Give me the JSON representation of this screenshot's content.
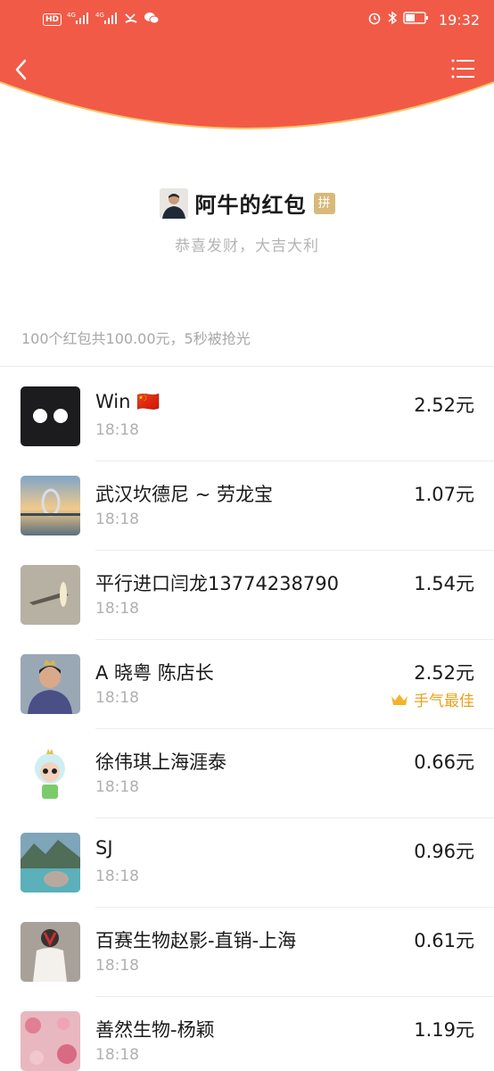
{
  "status_bar": {
    "hd_label": "HD",
    "signal_label_1": "4G",
    "signal_label_2": "4G",
    "time": "19:32"
  },
  "sender": {
    "name": "阿牛的红包",
    "badge": "拼",
    "blessing": "恭喜发财，大吉大利"
  },
  "summary": "100个红包共100.00元，5秒被抢光",
  "colors": {
    "header_red": "#f15a47",
    "best_luck_gold": "#e9a21d",
    "pin_badge": "#d9b97b"
  },
  "recipients": [
    {
      "name": "Win 🇨🇳",
      "time": "18:18",
      "amount": "2.52元",
      "best": ""
    },
    {
      "name": "武汉坎德尼 ~ 劳龙宝",
      "time": "18:18",
      "amount": "1.07元",
      "best": ""
    },
    {
      "name": "平行进口闫龙13774238790",
      "time": "18:18",
      "amount": "1.54元",
      "best": ""
    },
    {
      "name": "A 晓粤 陈店长",
      "time": "18:18",
      "amount": "2.52元",
      "best": "手气最佳"
    },
    {
      "name": "徐伟琪上海涯泰",
      "time": "18:18",
      "amount": "0.66元",
      "best": ""
    },
    {
      "name": "SJ",
      "time": "18:18",
      "amount": "0.96元",
      "best": ""
    },
    {
      "name": "百赛生物赵影-直销-上海",
      "time": "18:18",
      "amount": "0.61元",
      "best": ""
    },
    {
      "name": "善然生物-杨颖",
      "time": "18:18",
      "amount": "1.19元",
      "best": ""
    }
  ]
}
